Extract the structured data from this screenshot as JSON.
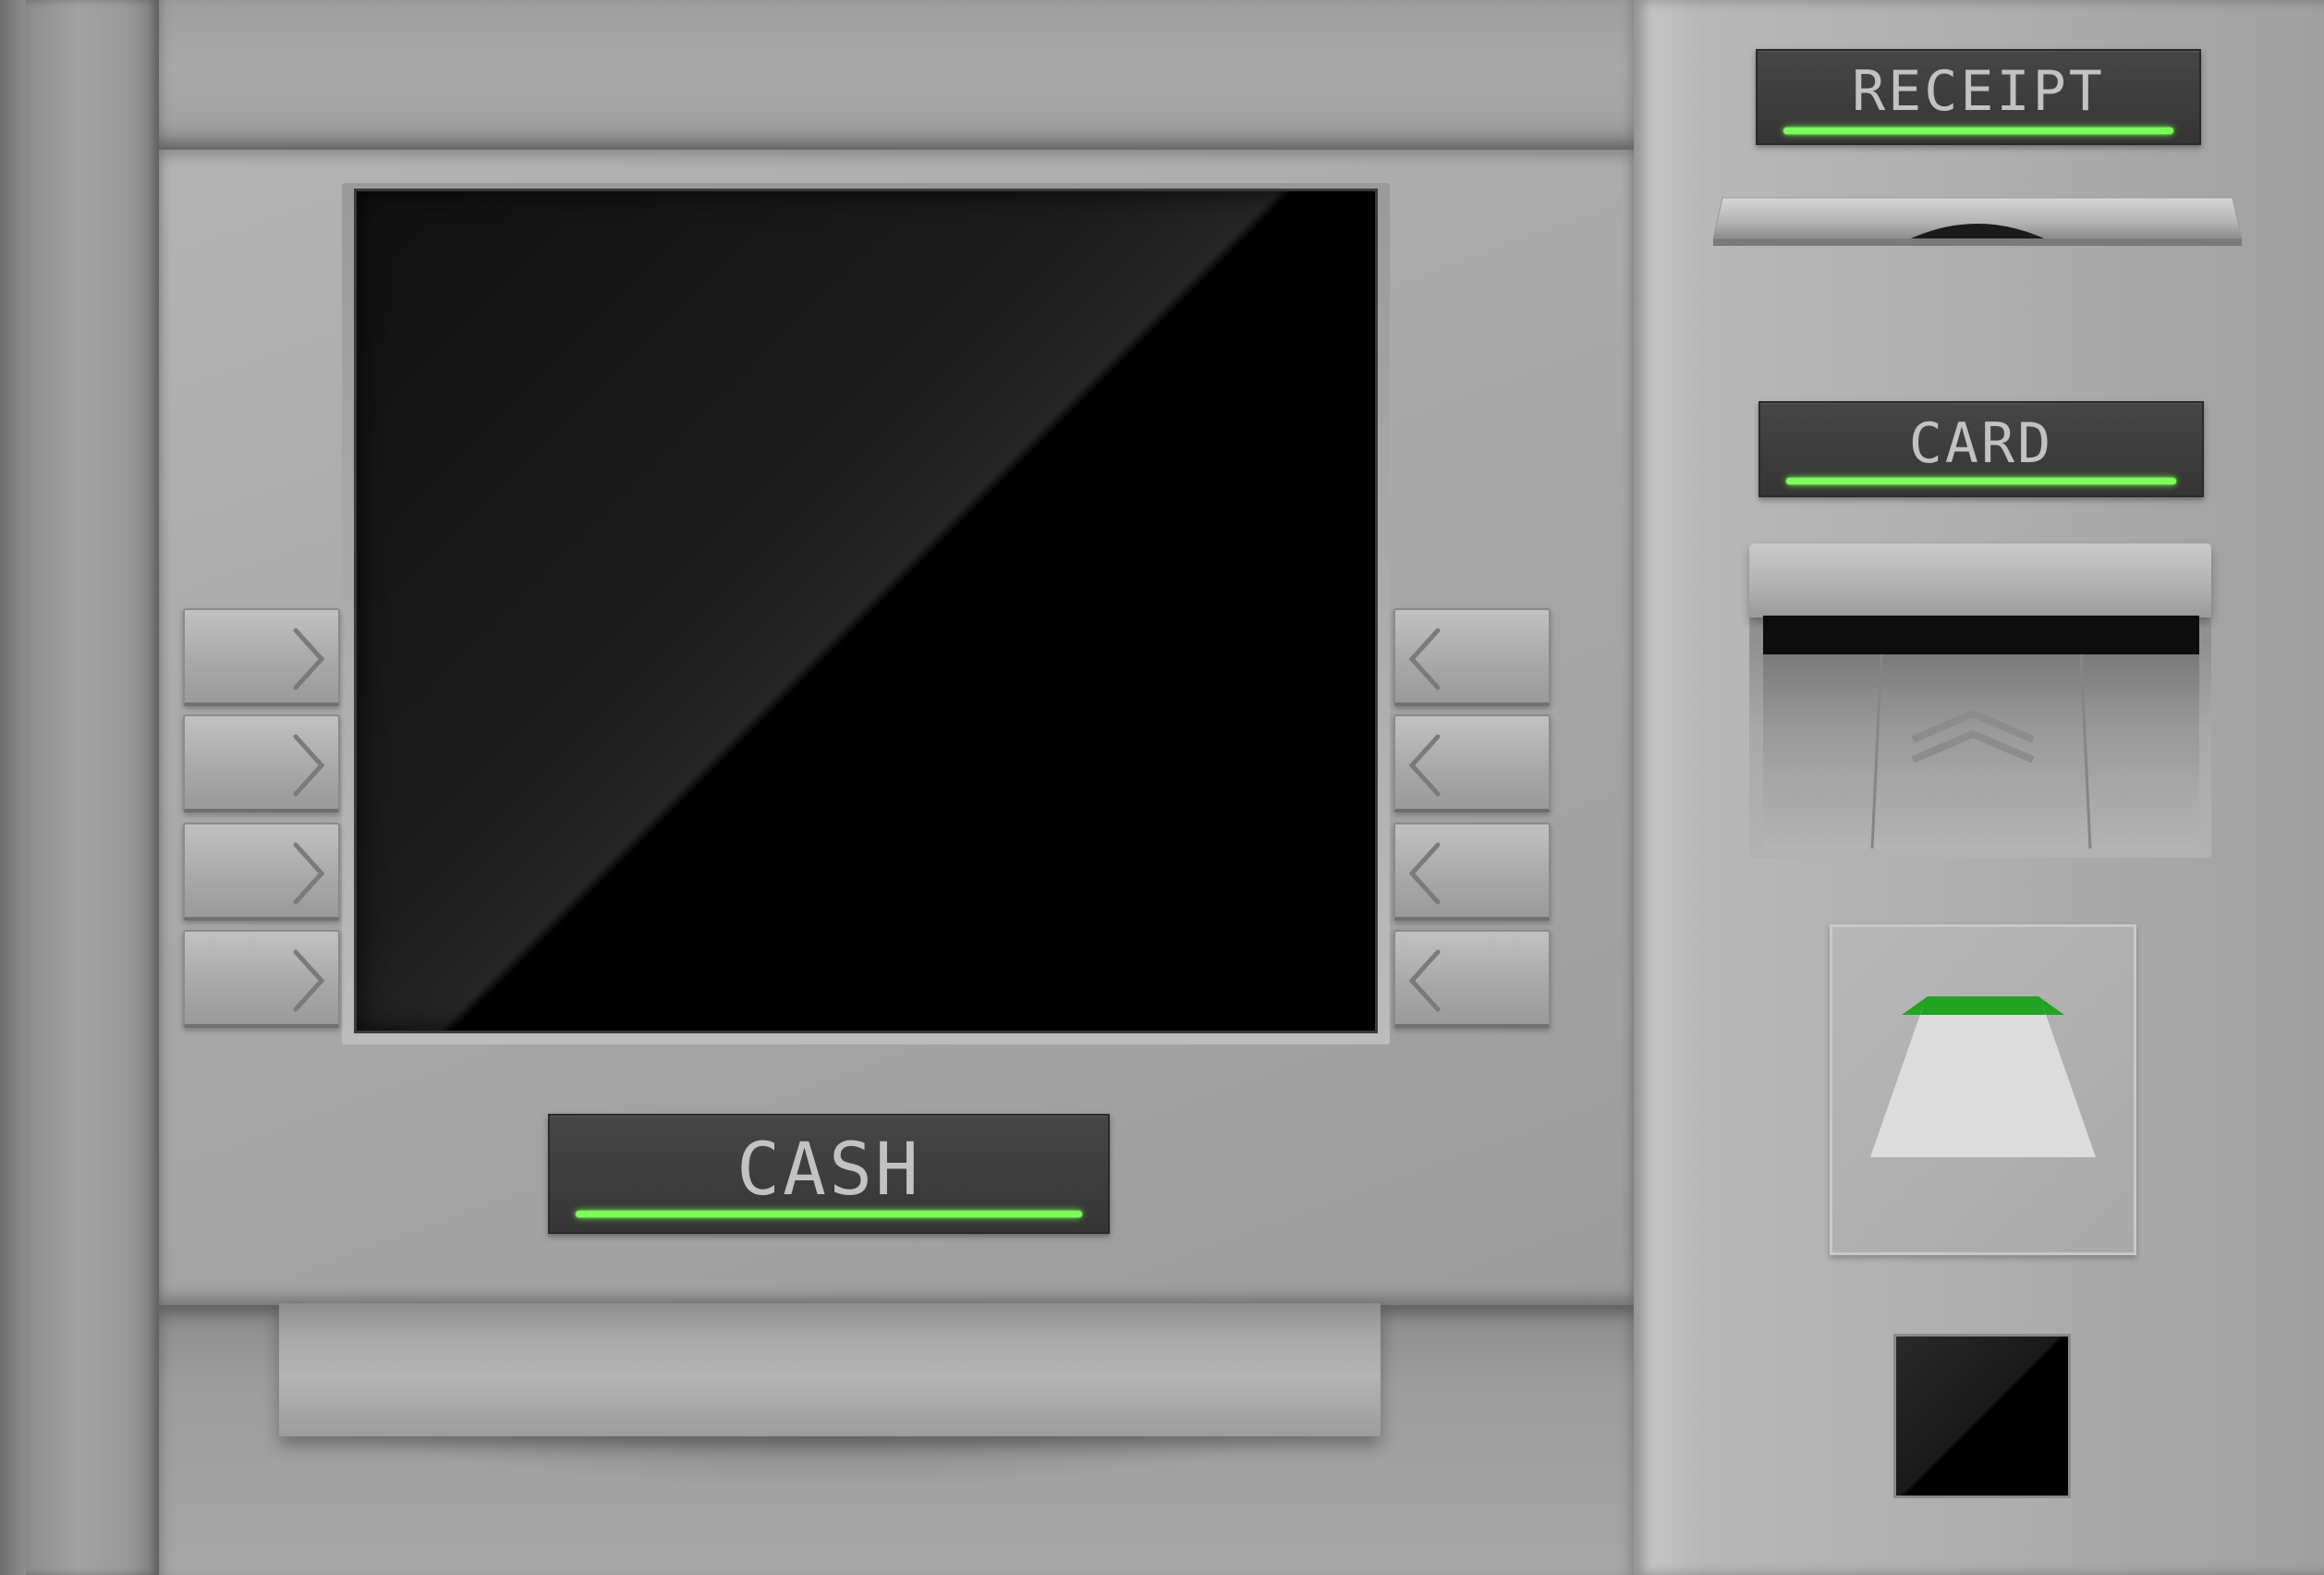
{
  "labels": {
    "receipt": "RECEIPT",
    "card": "CARD",
    "cash": "CASH"
  },
  "side_keys": {
    "left": [
      "key-left-1",
      "key-left-2",
      "key-left-3",
      "key-left-4"
    ],
    "right": [
      "key-right-1",
      "key-right-2",
      "key-right-3",
      "key-right-4"
    ]
  },
  "colors": {
    "indicator_led": "#7cff5a",
    "deposit_indicator": "#22a322",
    "label_background": "#3d3d3d",
    "label_text": "#c2c2c2",
    "screen": "#000000"
  },
  "icons": {
    "left_key": "chevron-right-icon",
    "right_key": "chevron-left-icon",
    "card_insert": "double-chevron-up-icon",
    "deposit": "deposit-tray-icon"
  }
}
